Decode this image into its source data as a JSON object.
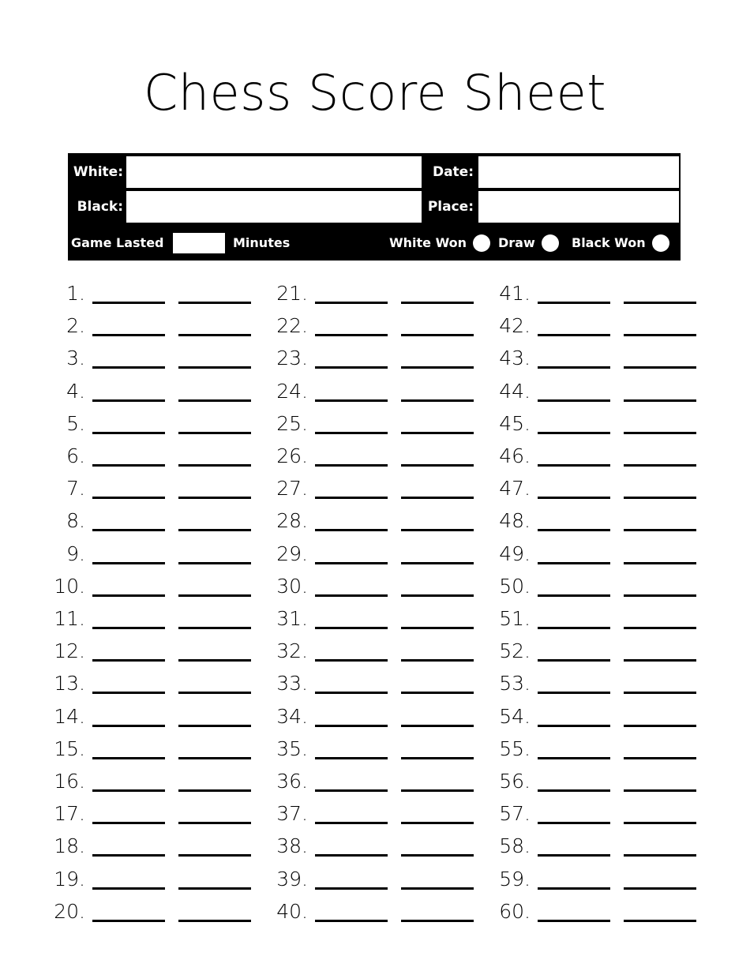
{
  "page": {
    "title": "Chess Score Sheet"
  },
  "header": {
    "white_label": "White:",
    "black_label": "Black:",
    "date_label": "Date:",
    "place_label": "Place:",
    "white_value": "",
    "black_value": "",
    "date_value": "",
    "place_value": "",
    "white_placeholder": "",
    "black_placeholder": "",
    "date_placeholder": "",
    "place_placeholder": ""
  },
  "result": {
    "game_lasted_label": "Game Lasted",
    "minutes_label": "Minutes",
    "minutes_value": "",
    "minutes_placeholder": "",
    "options": [
      {
        "label": "White  Won",
        "icon": "radio-circle-icon"
      },
      {
        "label": "Draw",
        "icon": "radio-circle-icon"
      },
      {
        "label": "Black Won",
        "icon": "radio-circle-icon"
      }
    ]
  },
  "moves": {
    "columns": [
      {
        "rows": [
          {
            "number": "1."
          },
          {
            "number": "2."
          },
          {
            "number": "3."
          },
          {
            "number": "4."
          },
          {
            "number": "5."
          },
          {
            "number": "6."
          },
          {
            "number": "7."
          },
          {
            "number": "8."
          },
          {
            "number": "9."
          },
          {
            "number": "10."
          },
          {
            "number": "11."
          },
          {
            "number": "12."
          },
          {
            "number": "13."
          },
          {
            "number": "14."
          },
          {
            "number": "15."
          },
          {
            "number": "16."
          },
          {
            "number": "17."
          },
          {
            "number": "18."
          },
          {
            "number": "19."
          },
          {
            "number": "20."
          }
        ]
      },
      {
        "rows": [
          {
            "number": "21."
          },
          {
            "number": "22."
          },
          {
            "number": "23."
          },
          {
            "number": "24."
          },
          {
            "number": "25."
          },
          {
            "number": "26."
          },
          {
            "number": "27."
          },
          {
            "number": "28."
          },
          {
            "number": "29."
          },
          {
            "number": "30."
          },
          {
            "number": "31."
          },
          {
            "number": "32."
          },
          {
            "number": "33."
          },
          {
            "number": "34."
          },
          {
            "number": "35."
          },
          {
            "number": "36."
          },
          {
            "number": "37."
          },
          {
            "number": "38."
          },
          {
            "number": "39."
          },
          {
            "number": "40."
          }
        ]
      },
      {
        "rows": [
          {
            "number": "41."
          },
          {
            "number": "42."
          },
          {
            "number": "43."
          },
          {
            "number": "44."
          },
          {
            "number": "45."
          },
          {
            "number": "46."
          },
          {
            "number": "47."
          },
          {
            "number": "48."
          },
          {
            "number": "49."
          },
          {
            "number": "50."
          },
          {
            "number": "51."
          },
          {
            "number": "52."
          },
          {
            "number": "53."
          },
          {
            "number": "54."
          },
          {
            "number": "55."
          },
          {
            "number": "56."
          },
          {
            "number": "57."
          },
          {
            "number": "58."
          },
          {
            "number": "59."
          },
          {
            "number": "60."
          }
        ]
      }
    ]
  },
  "colors": {
    "ink": "#000000",
    "paper": "#ffffff",
    "header_block": "#000000",
    "header_text": "#ffffff"
  }
}
